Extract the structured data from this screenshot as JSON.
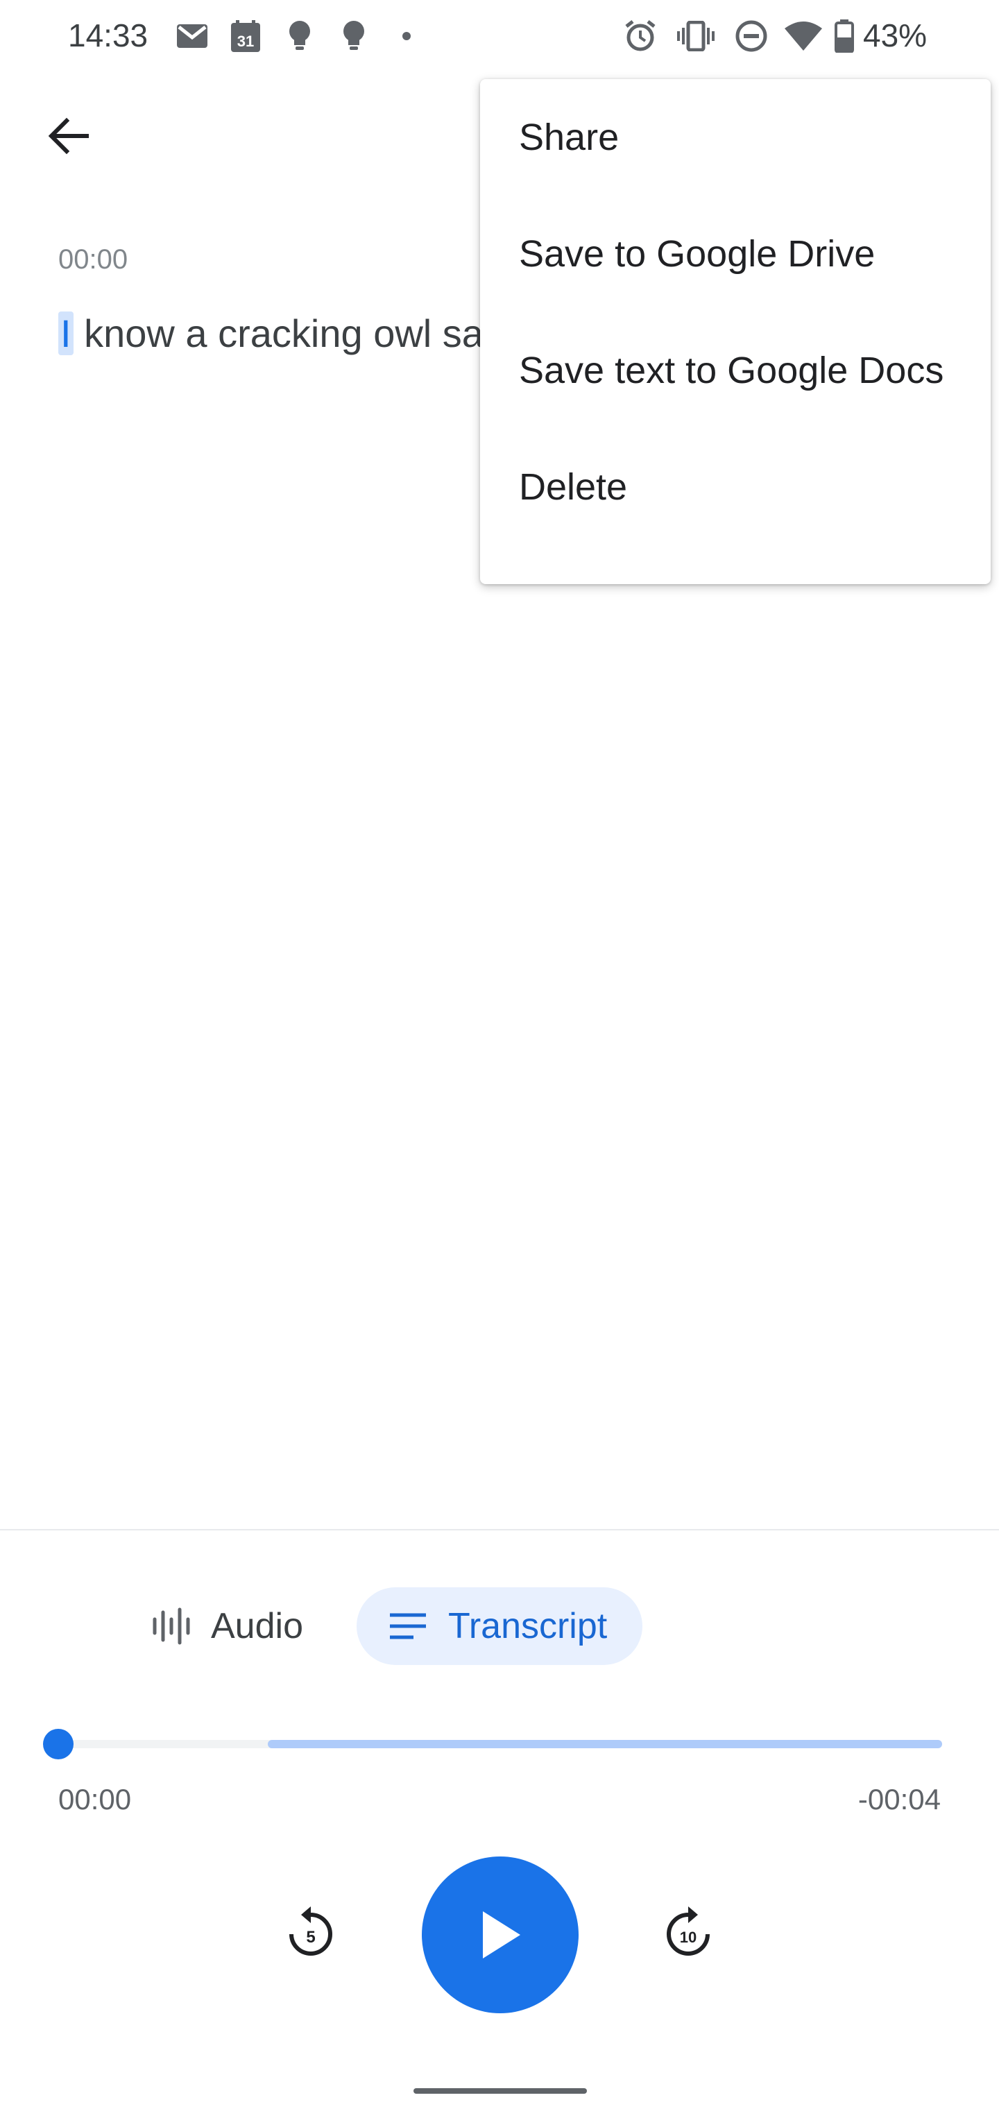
{
  "status_bar": {
    "time": "14:33",
    "left_icons": [
      "gmail-icon",
      "calendar-icon",
      "lightbulb-icon",
      "lightbulb-icon",
      "dot-icon"
    ],
    "calendar_day": "31",
    "right_icons": [
      "alarm-icon",
      "vibrate-icon",
      "do-not-disturb-icon",
      "wifi-icon",
      "battery-icon"
    ],
    "battery_percent": "43%"
  },
  "app_bar": {
    "back_icon": "arrow-back-icon"
  },
  "transcript": {
    "timestamp": "00:00",
    "highlighted_word": "I",
    "text_rest": " know a cracking owl sa"
  },
  "menu": {
    "items": [
      {
        "label": "Share"
      },
      {
        "label": "Save to Google Drive"
      },
      {
        "label": "Save text to Google Docs"
      },
      {
        "label": "Delete"
      }
    ]
  },
  "view_toggle": {
    "audio_label": "Audio",
    "audio_icon": "waveform-icon",
    "transcript_label": "Transcript",
    "transcript_icon": "lines-icon",
    "selected": "Transcript"
  },
  "player": {
    "elapsed": "00:00",
    "remaining": "-00:04",
    "progress": 0.0,
    "rewind_label": "5",
    "forward_label": "10"
  },
  "colors": {
    "accent": "#1a73e8",
    "accent_light": "#aecbfa",
    "selected_bg": "#e8f0fe",
    "highlight_bg": "#d2e3fc"
  }
}
